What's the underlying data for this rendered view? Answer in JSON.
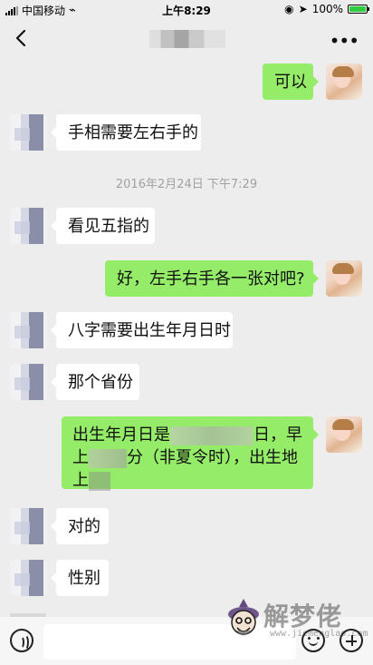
{
  "status_bar": {
    "carrier": "中国移动",
    "time": "上午8:29",
    "battery": "100%",
    "battery_level": 1.0
  },
  "header": {
    "title_icon": "pixelated-contact-name",
    "back_icon": "chevron-left-icon",
    "more_icon": "more-horizontal-icon"
  },
  "messages": [
    {
      "side": "right",
      "text": "可以",
      "avatar": "contact-photo"
    },
    {
      "side": "left",
      "text": "手相需要左右手的",
      "avatar": "pixelated-avatar"
    },
    {
      "side": "center",
      "text": "2016年2月24日 下午7:29"
    },
    {
      "side": "left",
      "text": "看见五指的",
      "avatar": "pixelated-avatar"
    },
    {
      "side": "right",
      "text": "好，左手右手各一张对吧?",
      "avatar": "contact-photo"
    },
    {
      "side": "left",
      "text": "八字需要出生年月日时",
      "avatar": "pixelated-avatar"
    },
    {
      "side": "left",
      "text": "那个省份",
      "avatar": "pixelated-avatar"
    },
    {
      "side": "right",
      "avatar": "contact-photo",
      "lines": [
        "出生年月日是",
        "日，早",
        "上",
        "分（非夏令时），出生地",
        "上"
      ]
    },
    {
      "side": "left",
      "text": "对的",
      "avatar": "pixelated-avatar"
    },
    {
      "side": "left",
      "text": "性别",
      "avatar": "pixelated-avatar"
    }
  ],
  "input_bar": {
    "voice_icon": "voice-input-icon",
    "emoji_icon": "emoji-icon",
    "plus_icon": "plus-circle-icon",
    "placeholder": ""
  },
  "watermark": {
    "text": "解梦佬",
    "url": "www.jiemenglao.com"
  },
  "colors": {
    "page_background": "#ededed",
    "incoming_bubble": "#ffffff",
    "outgoing_bubble": "#95ec69",
    "timestamp": "#a1a1a1"
  }
}
